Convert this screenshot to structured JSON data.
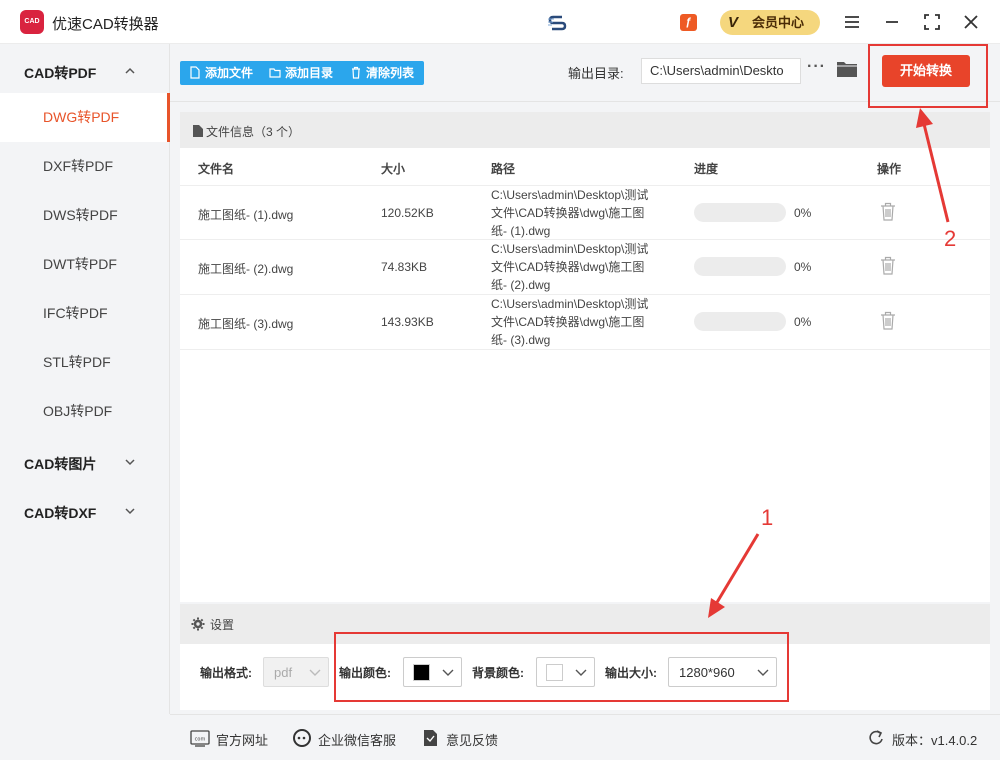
{
  "app": {
    "logo_text": "CAD",
    "title": "优速CAD转换器",
    "sync_text": "",
    "vip_label": "会员中心"
  },
  "icons": {
    "promo": "promo-icon",
    "vip": "vip-badge-icon",
    "menu": "hamburger-icon",
    "minimize": "minimize-icon",
    "maximize": "fullscreen-icon",
    "close": "close-icon"
  },
  "sidebar": {
    "groups": [
      {
        "label": "CAD转PDF",
        "expanded": true
      },
      {
        "label": "CAD转图片",
        "expanded": false
      },
      {
        "label": "CAD转DXF",
        "expanded": false
      }
    ],
    "items": [
      "DWG转PDF",
      "DXF转PDF",
      "DWS转PDF",
      "DWT转PDF",
      "IFC转PDF",
      "STL转PDF",
      "OBJ转PDF"
    ],
    "active_item": "DWG转PDF"
  },
  "toolbar": {
    "add_file": "添加文件",
    "add_folder": "添加目录",
    "clear_list": "清除列表",
    "output_label": "输出目录:",
    "output_path": "C:\\Users\\admin\\Deskto",
    "start": "开始转换"
  },
  "files": {
    "header": "文件信息（3 个）",
    "columns": [
      "文件名",
      "大小",
      "路径",
      "进度",
      "操作"
    ],
    "rows": [
      {
        "name": "施工图纸- (1).dwg",
        "size": "120.52KB",
        "path": [
          "C:\\Users\\admin\\Desktop\\测试",
          "文件\\CAD转换器\\dwg\\施工图",
          "纸- (1).dwg"
        ],
        "progress_pct": 0,
        "progress_text": "0%"
      },
      {
        "name": "施工图纸- (2).dwg",
        "size": "74.83KB",
        "path": [
          "C:\\Users\\admin\\Desktop\\测试",
          "文件\\CAD转换器\\dwg\\施工图",
          "纸- (2).dwg"
        ],
        "progress_pct": 0,
        "progress_text": "0%"
      },
      {
        "name": "施工图纸- (3).dwg",
        "size": "143.93KB",
        "path": [
          "C:\\Users\\admin\\Desktop\\测试",
          "文件\\CAD转换器\\dwg\\施工图",
          "纸- (3).dwg"
        ],
        "progress_pct": 0,
        "progress_text": "0%"
      }
    ]
  },
  "settings": {
    "header": "设置",
    "format_label": "输出格式:",
    "format_value": "pdf",
    "color_label": "输出颜色:",
    "color_value": "#000000",
    "bg_label": "背景颜色:",
    "bg_value": "#ffffff",
    "size_label": "输出大小:",
    "size_value": "1280*960"
  },
  "footer": {
    "website": "官方网址",
    "wechat": "企业微信客服",
    "feedback": "意见反馈",
    "version": "版本：v1.4.0.2"
  },
  "annotations": {
    "one": "1",
    "two": "2"
  },
  "colors": {
    "accent": "#e8542a",
    "start": "#e8442a",
    "toolbar_blue": "#2ba6ec",
    "highlight": "#e53935",
    "vip": "#f5d77e"
  }
}
